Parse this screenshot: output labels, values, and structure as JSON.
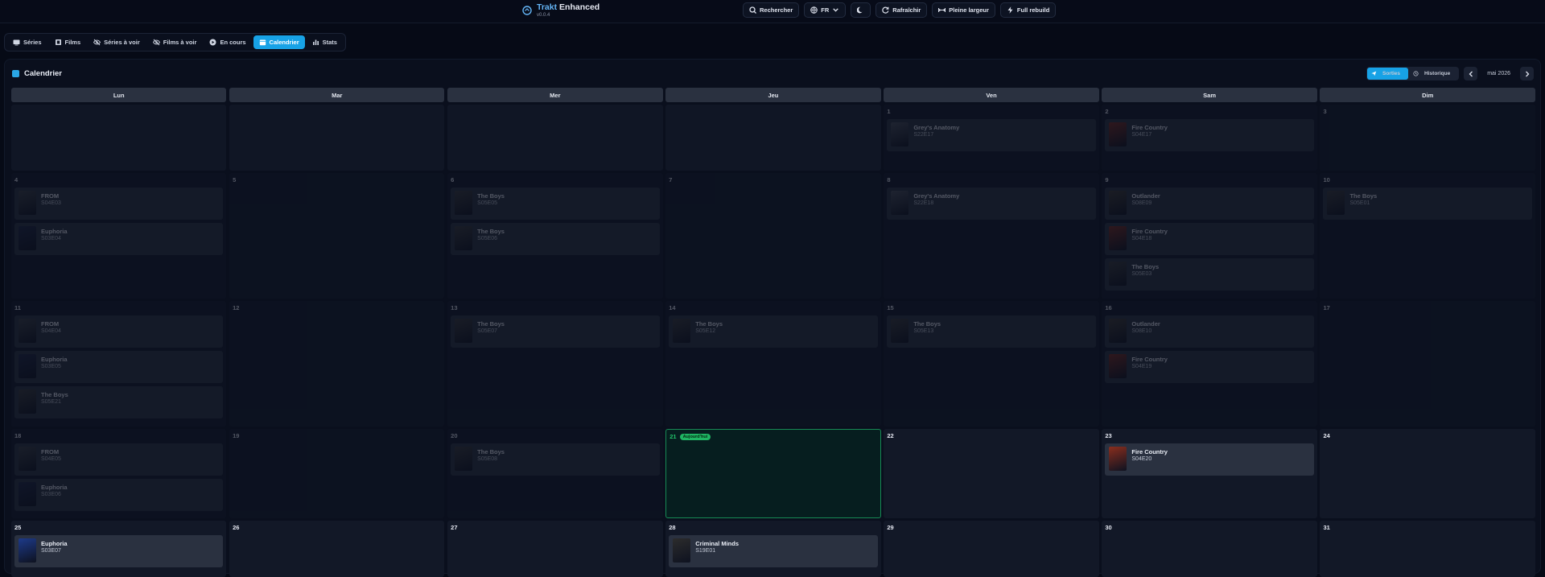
{
  "header": {
    "brand_part1": "Trakt",
    "brand_part2": "Enhanced",
    "version": "v0.0.4",
    "buttons": [
      {
        "name": "search-button",
        "icon": "search-icon",
        "label": "Rechercher"
      },
      {
        "name": "language-select",
        "icon": "globe-icon",
        "label": "FR",
        "dropdown": true
      },
      {
        "name": "theme-toggle-button",
        "icon": "moon-icon",
        "label": ""
      },
      {
        "name": "refresh-button",
        "icon": "refresh-icon",
        "label": "Rafraîchir"
      },
      {
        "name": "full-width-button",
        "icon": "expand-width-icon",
        "label": "Pleine largeur"
      },
      {
        "name": "full-rebuild-button",
        "icon": "bolt-icon",
        "label": "Full rebuild"
      }
    ]
  },
  "tabs": [
    {
      "id": "series",
      "icon": "tv-icon",
      "label": "Séries",
      "active": false
    },
    {
      "id": "films",
      "icon": "film-icon",
      "label": "Films",
      "active": false
    },
    {
      "id": "series-to-watch",
      "icon": "eye-off-icon",
      "label": "Séries à voir",
      "active": false
    },
    {
      "id": "films-to-watch",
      "icon": "eye-off-icon",
      "label": "Films à voir",
      "active": false
    },
    {
      "id": "in-progress",
      "icon": "play-circle-icon",
      "label": "En cours",
      "active": false
    },
    {
      "id": "calendar",
      "icon": "calendar-icon",
      "label": "Calendrier",
      "active": true
    },
    {
      "id": "stats",
      "icon": "bar-chart-icon",
      "label": "Stats",
      "active": false
    }
  ],
  "calendar": {
    "title": "Calendrier",
    "view_toggle": [
      {
        "label": "Sorties",
        "icon": "send-icon",
        "active": true
      },
      {
        "label": "Historique",
        "icon": "history-icon",
        "active": false
      }
    ],
    "month_label": "mai 2026",
    "weekdays": [
      "Lun",
      "Mar",
      "Mer",
      "Jeu",
      "Ven",
      "Sam",
      "Dim"
    ],
    "today_badge": "Aujourd'hui",
    "weeks": [
      [
        {
          "day": ""
        },
        {
          "day": ""
        },
        {
          "day": ""
        },
        {
          "day": ""
        },
        {
          "day": "1",
          "past": true,
          "events": [
            {
              "title": "Grey's Anatomy",
              "code": "S22E17",
              "color": "#4a4f5a"
            }
          ]
        },
        {
          "day": "2",
          "past": true,
          "events": [
            {
              "title": "Fire Country",
              "code": "S04E17",
              "color": "#7a2a20"
            }
          ]
        },
        {
          "day": "3",
          "past": true,
          "events": []
        }
      ],
      [
        {
          "day": "4",
          "past": true,
          "events": [
            {
              "title": "FROM",
              "code": "S04E03",
              "color": "#3b3f44"
            },
            {
              "title": "Euphoria",
              "code": "S03E04",
              "color": "#1d2440"
            }
          ]
        },
        {
          "day": "5",
          "past": true,
          "events": []
        },
        {
          "day": "6",
          "past": true,
          "events": [
            {
              "title": "The Boys",
              "code": "S05E05",
              "color": "#3a3a3a"
            },
            {
              "title": "The Boys",
              "code": "S05E06",
              "color": "#3a3a3a"
            }
          ]
        },
        {
          "day": "7",
          "past": true,
          "events": []
        },
        {
          "day": "8",
          "past": true,
          "events": [
            {
              "title": "Grey's Anatomy",
              "code": "S22E18",
              "color": "#4a4f5a"
            }
          ]
        },
        {
          "day": "9",
          "past": true,
          "events": [
            {
              "title": "Outlander",
              "code": "S08E09",
              "color": "#3f3a33"
            },
            {
              "title": "Fire Country",
              "code": "S04E18",
              "color": "#7a2a20"
            },
            {
              "title": "The Boys",
              "code": "S05E03",
              "color": "#3a3a3a"
            }
          ]
        },
        {
          "day": "10",
          "past": true,
          "events": [
            {
              "title": "The Boys",
              "code": "S05E01",
              "color": "#3a3a3a"
            }
          ]
        }
      ],
      [
        {
          "day": "11",
          "past": true,
          "events": [
            {
              "title": "FROM",
              "code": "S04E04",
              "color": "#3b3f44"
            },
            {
              "title": "Euphoria",
              "code": "S03E05",
              "color": "#1d2440"
            },
            {
              "title": "The Boys",
              "code": "S05E21",
              "color": "#3a3a3a"
            }
          ]
        },
        {
          "day": "12",
          "past": true,
          "events": []
        },
        {
          "day": "13",
          "past": true,
          "events": [
            {
              "title": "The Boys",
              "code": "S05E07",
              "color": "#3a3a3a"
            }
          ]
        },
        {
          "day": "14",
          "past": true,
          "events": [
            {
              "title": "The Boys",
              "code": "S05E12",
              "color": "#3a3a3a"
            }
          ]
        },
        {
          "day": "15",
          "past": true,
          "events": [
            {
              "title": "The Boys",
              "code": "S05E13",
              "color": "#3a3a3a"
            }
          ]
        },
        {
          "day": "16",
          "past": true,
          "events": [
            {
              "title": "Outlander",
              "code": "S08E10",
              "color": "#3f3a33"
            },
            {
              "title": "Fire Country",
              "code": "S04E19",
              "color": "#7a2a20"
            }
          ]
        },
        {
          "day": "17",
          "past": true,
          "events": []
        }
      ],
      [
        {
          "day": "18",
          "past": true,
          "events": [
            {
              "title": "FROM",
              "code": "S04E05",
              "color": "#3b3f44"
            },
            {
              "title": "Euphoria",
              "code": "S03E06",
              "color": "#1d2440"
            }
          ]
        },
        {
          "day": "19",
          "past": true,
          "events": []
        },
        {
          "day": "20",
          "past": true,
          "events": [
            {
              "title": "The Boys",
              "code": "S05E08",
              "color": "#3a3a3a"
            }
          ]
        },
        {
          "day": "21",
          "today": true,
          "events": []
        },
        {
          "day": "22",
          "events": []
        },
        {
          "day": "23",
          "events": [
            {
              "title": "Fire Country",
              "code": "S04E20",
              "color": "#8a2e1e"
            }
          ]
        },
        {
          "day": "24",
          "events": []
        }
      ],
      [
        {
          "day": "25",
          "events": [
            {
              "title": "Euphoria",
              "code": "S03E07",
              "color": "#1d3a8a"
            }
          ]
        },
        {
          "day": "26",
          "events": []
        },
        {
          "day": "27",
          "events": []
        },
        {
          "day": "28",
          "events": [
            {
              "title": "Criminal Minds",
              "code": "S19E01",
              "color": "#2c2c2c"
            }
          ]
        },
        {
          "day": "29",
          "events": []
        },
        {
          "day": "30",
          "events": []
        },
        {
          "day": "31",
          "events": []
        }
      ]
    ]
  }
}
